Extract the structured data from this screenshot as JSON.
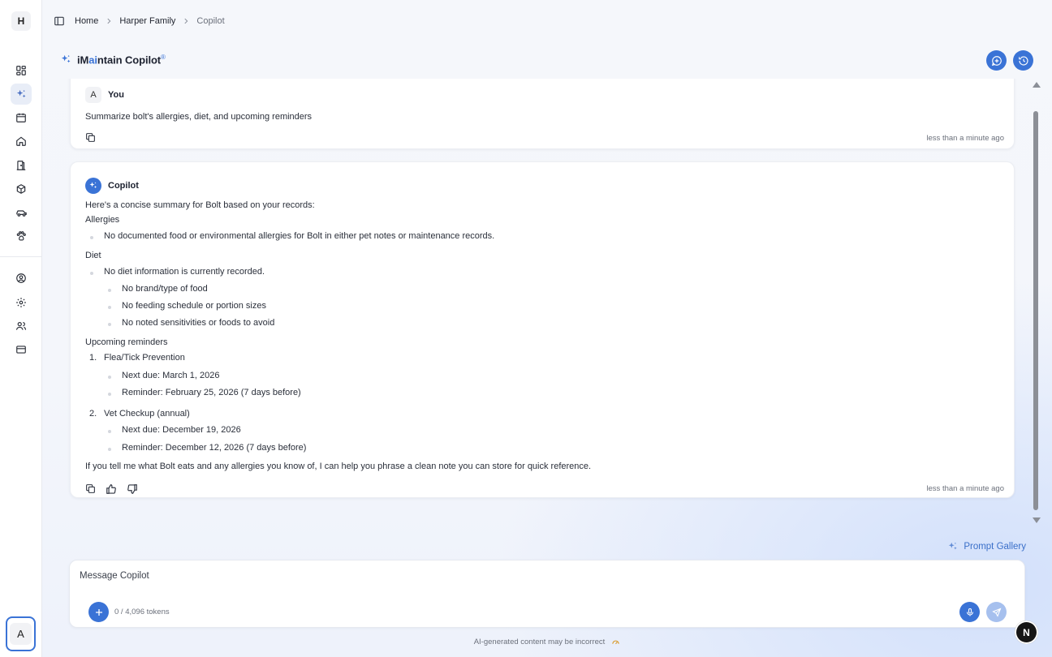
{
  "sidebar": {
    "brand_initial": "H",
    "items": [
      {
        "name": "dashboard",
        "icon": "grid-icon",
        "active": false
      },
      {
        "name": "copilot",
        "icon": "sparkle-icon",
        "active": true
      },
      {
        "name": "calendar",
        "icon": "calendar-icon",
        "active": false
      },
      {
        "name": "home",
        "icon": "home-icon",
        "active": false
      },
      {
        "name": "rooms",
        "icon": "door-icon",
        "active": false
      },
      {
        "name": "items",
        "icon": "box-icon",
        "active": false
      },
      {
        "name": "vehicles",
        "icon": "car-icon",
        "active": false
      },
      {
        "name": "pets",
        "icon": "paw-icon",
        "active": false
      },
      {
        "name": "profile",
        "icon": "user-circle-icon",
        "active": false
      },
      {
        "name": "settings",
        "icon": "gear-icon",
        "active": false
      },
      {
        "name": "members",
        "icon": "users-icon",
        "active": false
      },
      {
        "name": "billing",
        "icon": "credit-card-icon",
        "active": false
      }
    ],
    "account_initial": "A"
  },
  "breadcrumb": {
    "home": "Home",
    "family": "Harper Family",
    "current": "Copilot"
  },
  "header": {
    "title_pre": "iM",
    "title_accent": "ai",
    "title_post": "ntain Copilot",
    "title_reg": "®"
  },
  "user_message": {
    "avatar": "A",
    "author": "You",
    "text": "Summarize bolt's allergies, diet, and upcoming reminders",
    "timestamp": "less than a minute ago"
  },
  "bot_message": {
    "author": "Copilot",
    "intro": "Here's a concise summary for Bolt based on your records:",
    "allergies_heading": "Allergies",
    "allergies_item": "No documented food or environmental allergies for Bolt in either pet notes or maintenance records.",
    "diet_heading": "Diet",
    "diet_item": "No diet information is currently recorded.",
    "diet_subitems": [
      "No brand/type of food",
      "No feeding schedule or portion sizes",
      "No noted sensitivities or foods to avoid"
    ],
    "reminders_heading": "Upcoming reminders",
    "reminders": [
      {
        "num": "1.",
        "title": "Flea/Tick Prevention",
        "next_due": "Next due: March 1, 2026",
        "reminder": "Reminder: February 25, 2026 (7 days before)"
      },
      {
        "num": "2.",
        "title": "Vet Checkup (annual)",
        "next_due": "Next due: December 19, 2026",
        "reminder": "Reminder: December 12, 2026 (7 days before)"
      }
    ],
    "closing": "If you tell me what Bolt eats and any allergies you know of, I can help you phrase a clean note you can store for quick reference.",
    "timestamp": "less than a minute ago"
  },
  "prompt_gallery_label": "Prompt Gallery",
  "composer": {
    "placeholder": "Message Copilot",
    "token_count": "0 / 4,096 tokens"
  },
  "disclaimer": "AI-generated content may be incorrect",
  "corner_badge": "N",
  "colors": {
    "accent": "#3a73d6",
    "send_disabled": "#a6c0ee"
  }
}
